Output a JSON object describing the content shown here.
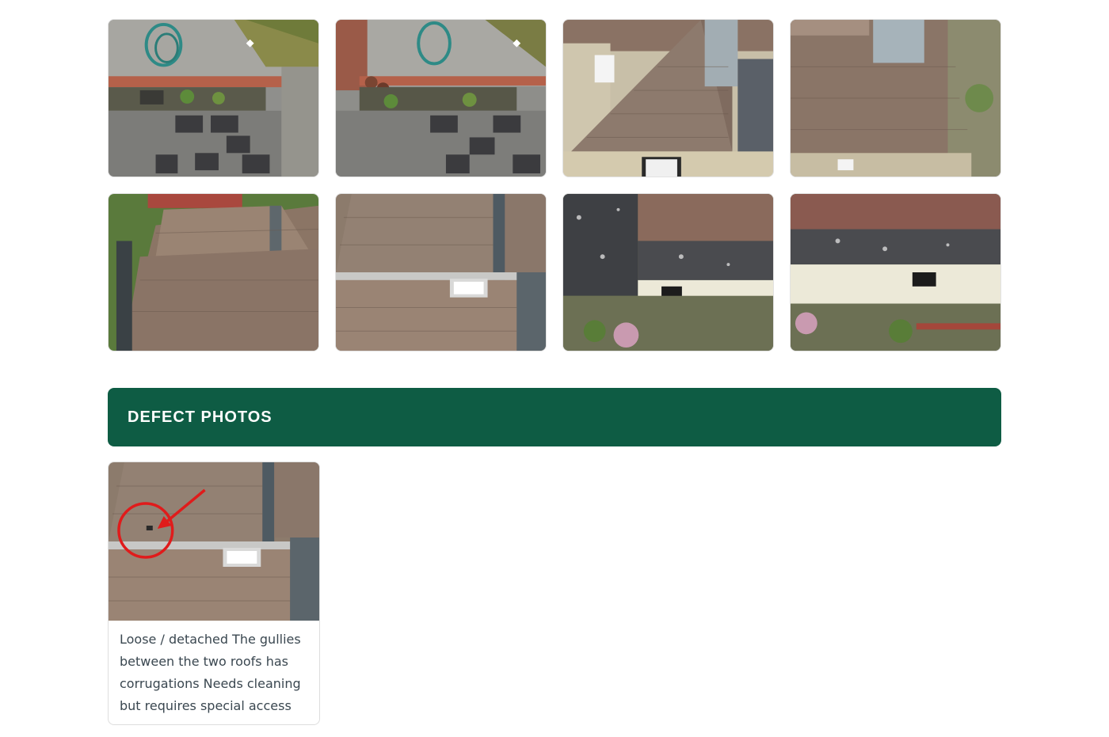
{
  "section": {
    "title": "DEFECT PHOTOS"
  },
  "gallery": {
    "photos": [
      {
        "subject": "garden-and-flat-roof-photo"
      },
      {
        "subject": "garden-and-flat-roof-photo"
      },
      {
        "subject": "pitched-roof-with-chimney-photo"
      },
      {
        "subject": "pitched-roof-with-chimney-photo"
      },
      {
        "subject": "tiled-roof-photo"
      },
      {
        "subject": "tiled-roof-with-skylight-photo"
      },
      {
        "subject": "flat-roof-and-wall-photo"
      },
      {
        "subject": "flat-roof-and-wall-photo"
      }
    ]
  },
  "defects": [
    {
      "caption": "Loose / detached The gullies between the two roofs has corrugations Needs cleaning but requires special access"
    }
  ],
  "colors": {
    "header_bg": "#0e5c44",
    "header_text": "#ffffff",
    "caption_text": "#3a4750",
    "annotation_red": "#e01b1b"
  }
}
